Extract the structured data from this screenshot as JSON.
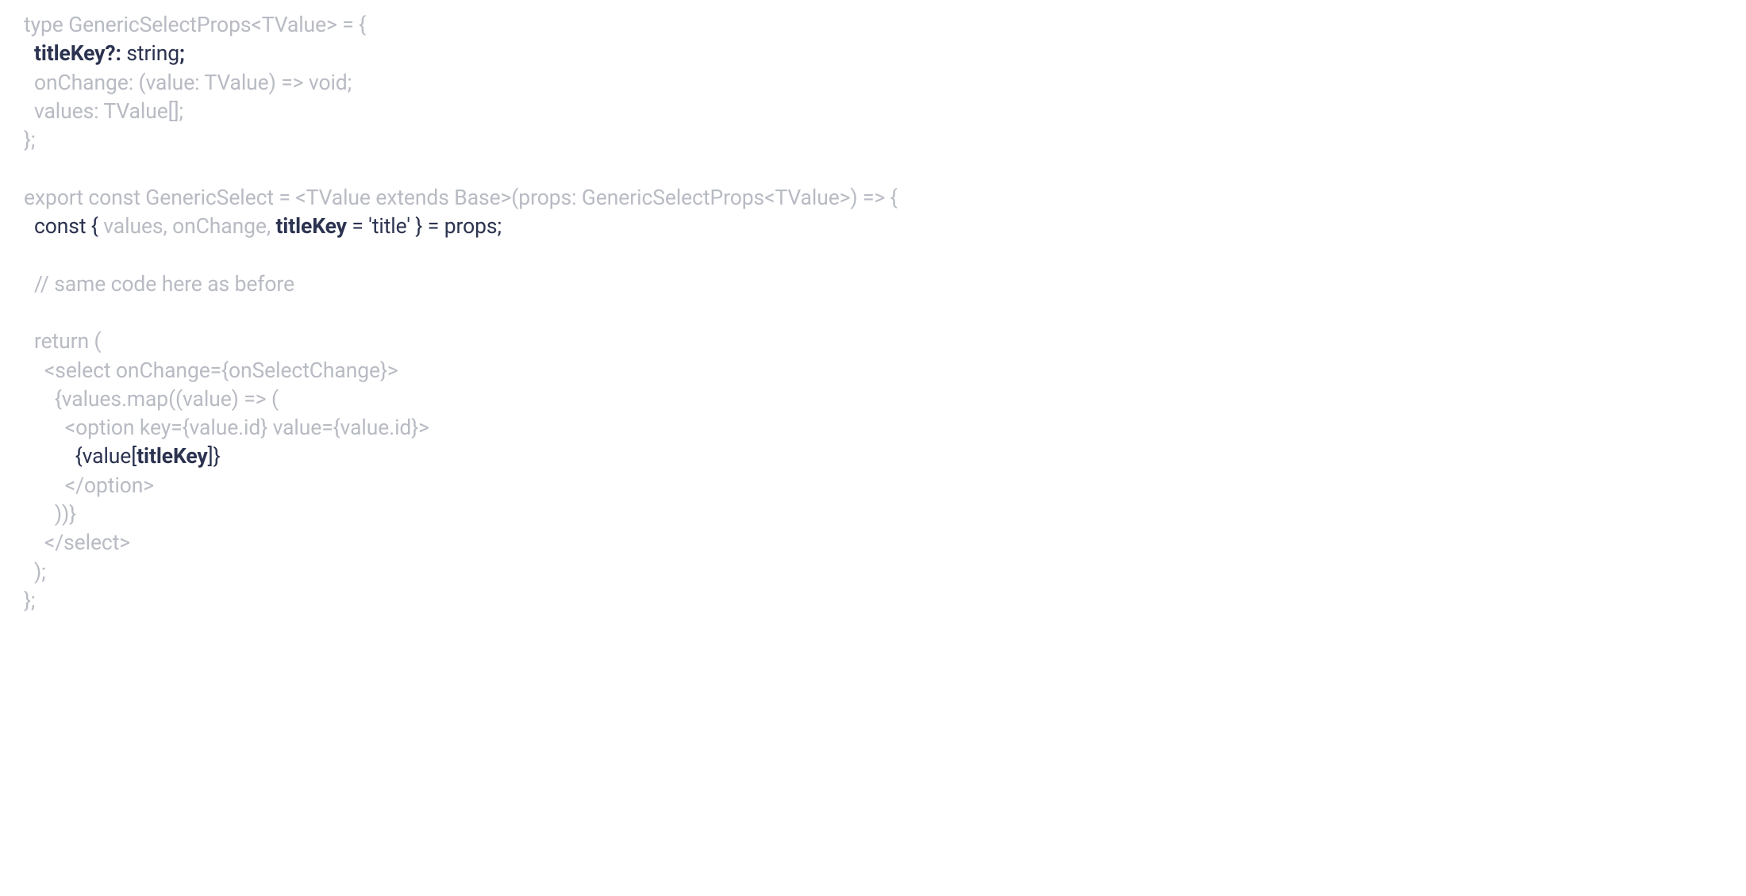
{
  "code": {
    "l1": "type GenericSelectProps<TValue> = {",
    "l2a": "  ",
    "l2b": "titleKey?:",
    "l2c": " string",
    "l2d": ";",
    "l3": "  onChange: (value: TValue) => void;",
    "l4": "  values: TValue[];",
    "l5": "};",
    "l6": "",
    "l7": "export const GenericSelect = <TValue extends Base>(props: GenericSelectProps<TValue>) => {",
    "l8a": "  const {",
    "l8b": " values, onChange, ",
    "l8c": "titleKey",
    "l8d": " = 'title' } = props;",
    "l9": "",
    "l10": "  // same code here as before",
    "l11": "",
    "l12": "  return (",
    "l13": "    <select onChange={onSelectChange}>",
    "l14": "      {values.map((value) => (",
    "l15": "        <option key={value.id} value={value.id}>",
    "l16a": "          {value[",
    "l16b": "titleKey",
    "l16c": "]}",
    "l17": "        </option>",
    "l18": "      ))}",
    "l19": "    </select>",
    "l20": "  );",
    "l21": "};"
  }
}
